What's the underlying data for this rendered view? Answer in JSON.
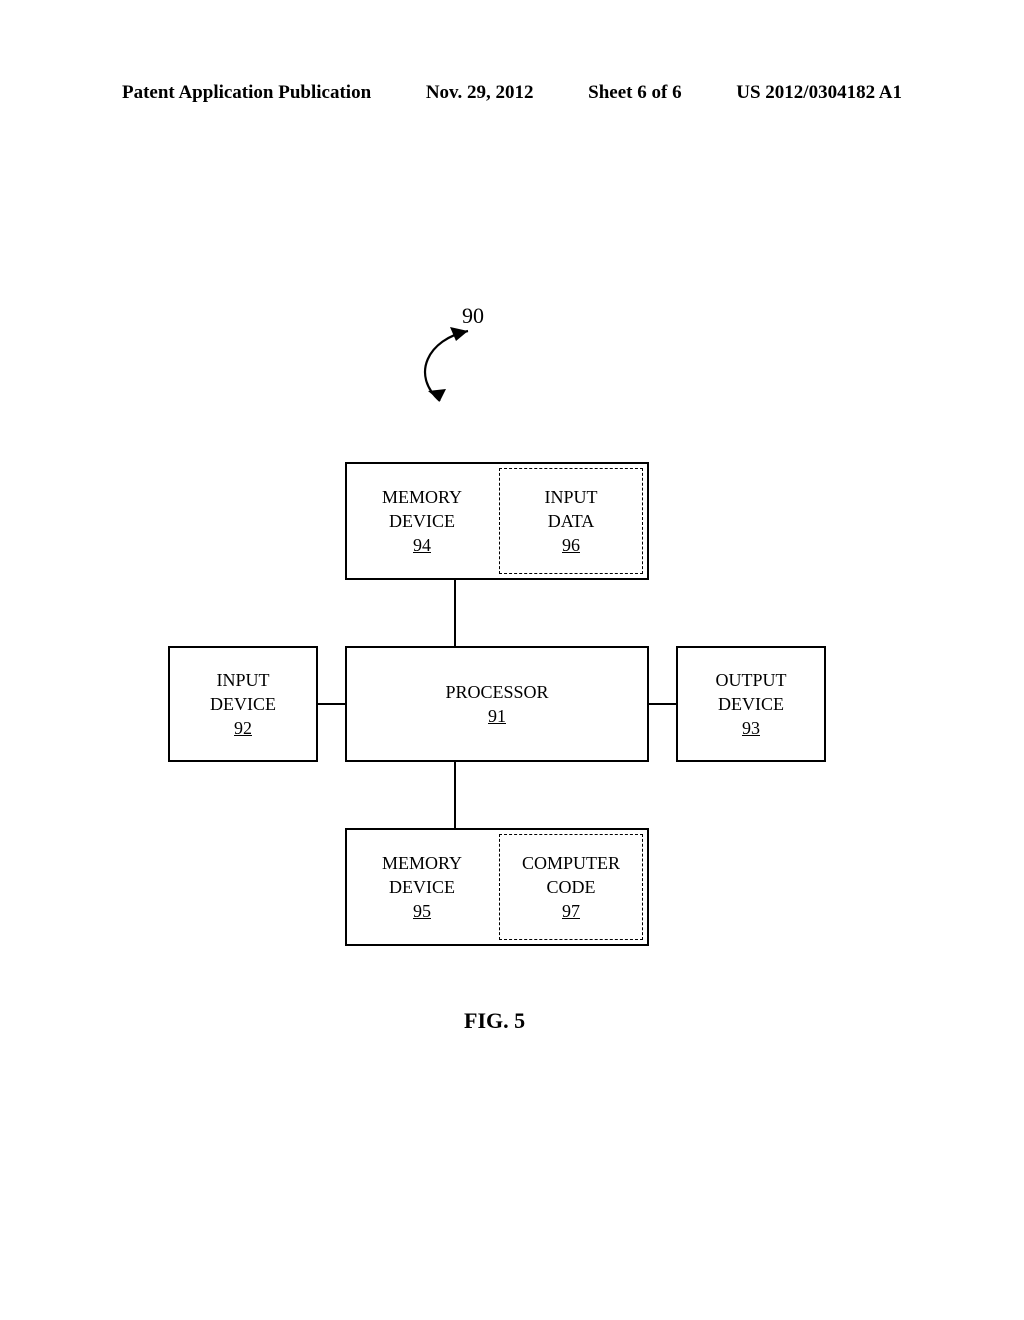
{
  "header": {
    "pub_type": "Patent Application Publication",
    "date": "Nov. 29, 2012",
    "sheet": "Sheet 6 of 6",
    "doc_number": "US 2012/0304182 A1"
  },
  "system_ref": "90",
  "boxes": {
    "memory_top": {
      "label": "MEMORY DEVICE",
      "ref": "94"
    },
    "input_data": {
      "label1": "INPUT",
      "label2": "DATA",
      "ref": "96"
    },
    "input_device": {
      "label1": "INPUT",
      "label2": "DEVICE",
      "ref": "92"
    },
    "processor": {
      "label": "PROCESSOR",
      "ref": "91"
    },
    "output_device": {
      "label1": "OUTPUT",
      "label2": "DEVICE",
      "ref": "93"
    },
    "memory_bottom": {
      "label": "MEMORY DEVICE",
      "ref": "95"
    },
    "computer_code": {
      "label1": "COMPUTER",
      "label2": "CODE",
      "ref": "97"
    }
  },
  "figure_label": "FIG. 5"
}
